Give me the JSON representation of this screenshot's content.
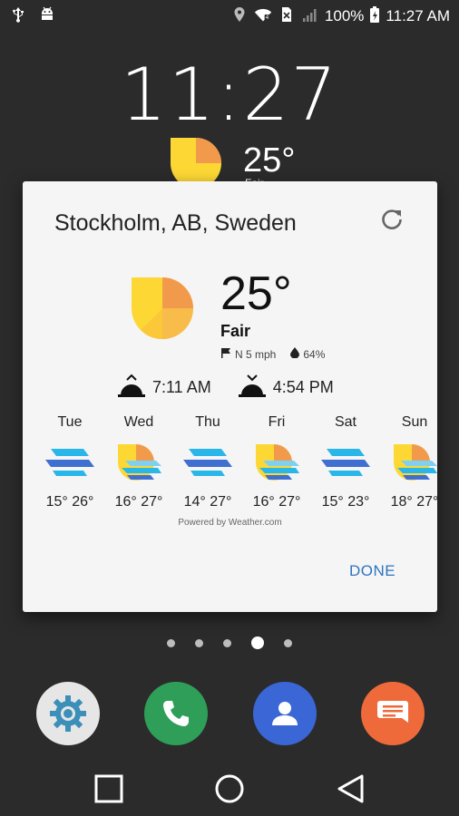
{
  "status_bar": {
    "battery": "100%",
    "time": "11:27 AM"
  },
  "lock_clock": "11:27",
  "home_weather": {
    "temp": "25°",
    "cond": "Fair"
  },
  "dialog": {
    "location": "Stockholm, AB, Sweden",
    "temperature": "25°",
    "condition": "Fair",
    "wind": "N 5 mph",
    "humidity": "64%",
    "sunrise": "7:11 AM",
    "sunset": "4:54 PM",
    "forecast": [
      {
        "day": "Tue",
        "temps": "15° 26°",
        "icon": "windy-icon"
      },
      {
        "day": "Wed",
        "temps": "16° 27°",
        "icon": "partly-cloudy-wind-icon"
      },
      {
        "day": "Thu",
        "temps": "14° 27°",
        "icon": "windy-icon"
      },
      {
        "day": "Fri",
        "temps": "16° 27°",
        "icon": "partly-cloudy-wind-icon"
      },
      {
        "day": "Sat",
        "temps": "15° 23°",
        "icon": "windy-icon"
      },
      {
        "day": "Sun",
        "temps": "18° 27°",
        "icon": "partly-cloudy-wind-icon"
      }
    ],
    "powered_by": "Powered by Weather.com",
    "done_label": "DONE"
  },
  "page_indicator": {
    "count": 5,
    "active": 4
  },
  "dock_apps": [
    "settings-app",
    "phone-app",
    "contacts-app",
    "messages-app"
  ],
  "colors": {
    "background": "#2b2b2b",
    "dialog": "#f5f5f5",
    "accent": "#2f74c0",
    "sun_yellow": "#fdd835",
    "sun_orange": "#f29a4b",
    "phone_green": "#2e9e58",
    "contacts_blue": "#3a66d6",
    "messages_orange": "#ef6a3a"
  }
}
